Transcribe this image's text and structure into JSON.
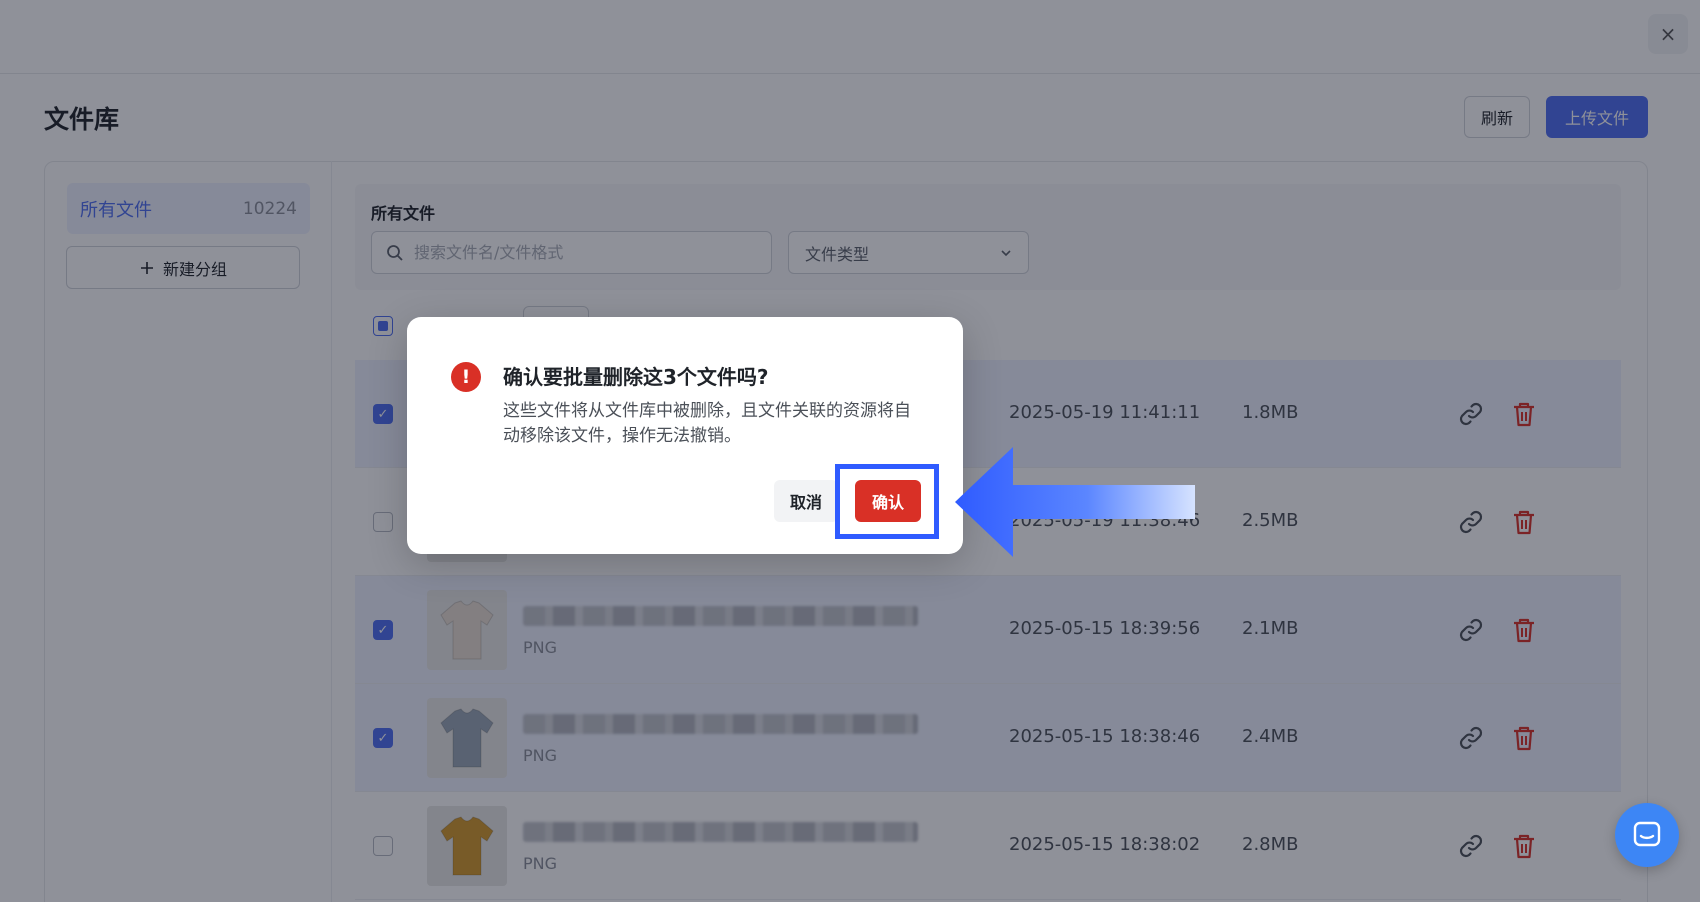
{
  "header": {
    "close_glyph": "×",
    "page_title": "文件库",
    "refresh_label": "刷新",
    "upload_label": "上传文件"
  },
  "sidebar": {
    "all_files_label": "所有文件",
    "all_files_count": "10224",
    "new_group_label": "新建分组"
  },
  "filters": {
    "section_title": "所有文件",
    "search_placeholder": "搜索文件名/文件格式",
    "type_select_value": "文件类型"
  },
  "files": [
    {
      "selected": true,
      "format": "",
      "date": "2025-05-19 11:41:11",
      "size": "1.8MB",
      "thumb_color": "#e7e3dc"
    },
    {
      "selected": false,
      "format": "",
      "date": "2025-05-19 11:38:46",
      "size": "2.5MB",
      "thumb_color": "#d8c9b4"
    },
    {
      "selected": true,
      "format": "PNG",
      "date": "2025-05-15 18:39:56",
      "size": "2.1MB",
      "thumb_color": "#e8ddd2"
    },
    {
      "selected": true,
      "format": "PNG",
      "date": "2025-05-15 18:38:46",
      "size": "2.4MB",
      "thumb_color": "#9aa7b6"
    },
    {
      "selected": false,
      "format": "PNG",
      "date": "2025-05-15 18:38:02",
      "size": "2.8MB",
      "thumb_color": "#d49a2a"
    }
  ],
  "dialog": {
    "icon_glyph": "!",
    "title": "确认要批量删除这3个文件吗?",
    "body": "这些文件将从文件库中被删除，且文件关联的资源将自动移除该文件，操作无法撤销。",
    "cancel_label": "取消",
    "confirm_label": "确认"
  },
  "colors": {
    "accent": "#4e6ef2",
    "danger": "#d93026",
    "highlight": "#2f5bff",
    "chat": "#3d86f5"
  },
  "icons": [
    "close-icon",
    "search-icon",
    "chevron-down-icon",
    "plus-icon",
    "link-icon",
    "trash-icon",
    "alert-icon",
    "chat-icon",
    "arrow-pointer"
  ]
}
